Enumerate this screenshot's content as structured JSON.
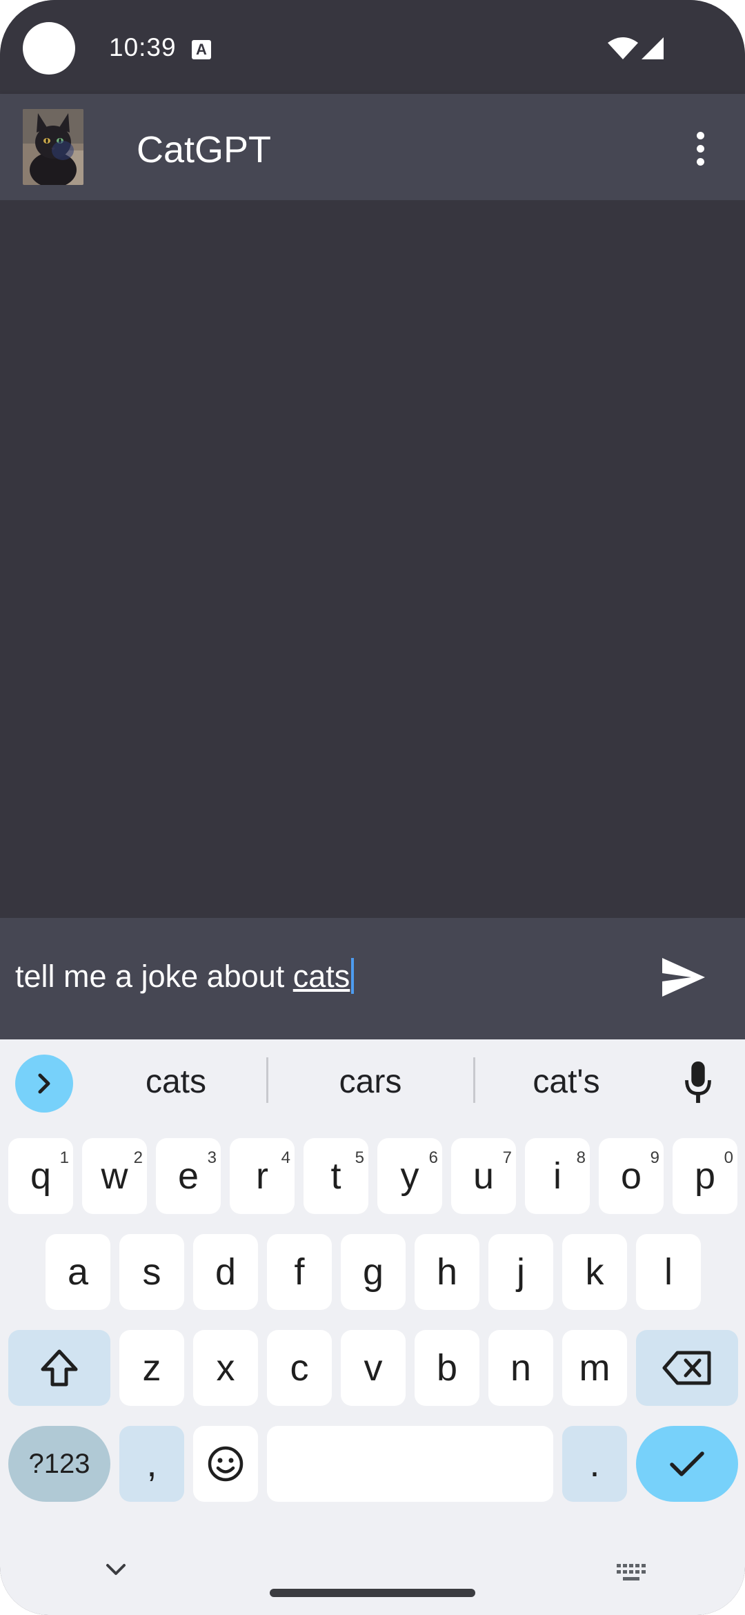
{
  "status_bar": {
    "time": "10:39",
    "notification_icon": "A",
    "icons": [
      "wifi-icon",
      "signal-icon"
    ]
  },
  "app_bar": {
    "title": "CatGPT",
    "avatar": "cat-avatar",
    "menu_icon": "overflow-menu-icon"
  },
  "composer": {
    "text_before": "tell me a joke about ",
    "text_composing": "cats",
    "send_icon": "send-icon"
  },
  "keyboard": {
    "suggestions": [
      "cats",
      "cars",
      "cat's"
    ],
    "row1": [
      {
        "label": "q",
        "hint": "1"
      },
      {
        "label": "w",
        "hint": "2"
      },
      {
        "label": "e",
        "hint": "3"
      },
      {
        "label": "r",
        "hint": "4"
      },
      {
        "label": "t",
        "hint": "5"
      },
      {
        "label": "y",
        "hint": "6"
      },
      {
        "label": "u",
        "hint": "7"
      },
      {
        "label": "i",
        "hint": "8"
      },
      {
        "label": "o",
        "hint": "9"
      },
      {
        "label": "p",
        "hint": "0"
      }
    ],
    "row2": [
      "a",
      "s",
      "d",
      "f",
      "g",
      "h",
      "j",
      "k",
      "l"
    ],
    "row3": [
      "z",
      "x",
      "c",
      "v",
      "b",
      "n",
      "m"
    ],
    "symbols_label": "?123",
    "comma_label": ",",
    "period_label": ".",
    "colors": {
      "accent": "#77d1fa",
      "function_key": "#d1e3f1",
      "symbols_key": "#b0c9d5"
    }
  }
}
